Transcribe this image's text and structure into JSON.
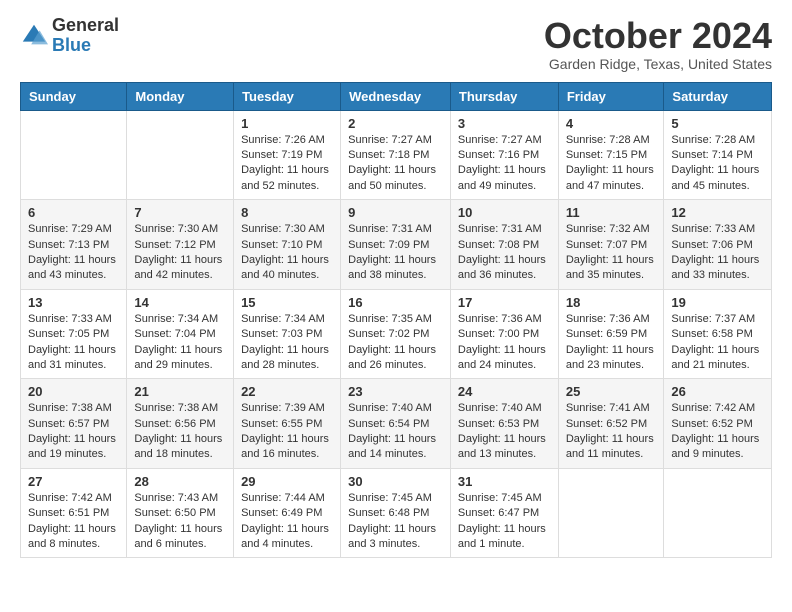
{
  "header": {
    "logo_general": "General",
    "logo_blue": "Blue",
    "month_title": "October 2024",
    "location": "Garden Ridge, Texas, United States"
  },
  "days_of_week": [
    "Sunday",
    "Monday",
    "Tuesday",
    "Wednesday",
    "Thursday",
    "Friday",
    "Saturday"
  ],
  "weeks": [
    [
      {
        "day": "",
        "sunrise": "",
        "sunset": "",
        "daylight": ""
      },
      {
        "day": "",
        "sunrise": "",
        "sunset": "",
        "daylight": ""
      },
      {
        "day": "1",
        "sunrise": "Sunrise: 7:26 AM",
        "sunset": "Sunset: 7:19 PM",
        "daylight": "Daylight: 11 hours and 52 minutes."
      },
      {
        "day": "2",
        "sunrise": "Sunrise: 7:27 AM",
        "sunset": "Sunset: 7:18 PM",
        "daylight": "Daylight: 11 hours and 50 minutes."
      },
      {
        "day": "3",
        "sunrise": "Sunrise: 7:27 AM",
        "sunset": "Sunset: 7:16 PM",
        "daylight": "Daylight: 11 hours and 49 minutes."
      },
      {
        "day": "4",
        "sunrise": "Sunrise: 7:28 AM",
        "sunset": "Sunset: 7:15 PM",
        "daylight": "Daylight: 11 hours and 47 minutes."
      },
      {
        "day": "5",
        "sunrise": "Sunrise: 7:28 AM",
        "sunset": "Sunset: 7:14 PM",
        "daylight": "Daylight: 11 hours and 45 minutes."
      }
    ],
    [
      {
        "day": "6",
        "sunrise": "Sunrise: 7:29 AM",
        "sunset": "Sunset: 7:13 PM",
        "daylight": "Daylight: 11 hours and 43 minutes."
      },
      {
        "day": "7",
        "sunrise": "Sunrise: 7:30 AM",
        "sunset": "Sunset: 7:12 PM",
        "daylight": "Daylight: 11 hours and 42 minutes."
      },
      {
        "day": "8",
        "sunrise": "Sunrise: 7:30 AM",
        "sunset": "Sunset: 7:10 PM",
        "daylight": "Daylight: 11 hours and 40 minutes."
      },
      {
        "day": "9",
        "sunrise": "Sunrise: 7:31 AM",
        "sunset": "Sunset: 7:09 PM",
        "daylight": "Daylight: 11 hours and 38 minutes."
      },
      {
        "day": "10",
        "sunrise": "Sunrise: 7:31 AM",
        "sunset": "Sunset: 7:08 PM",
        "daylight": "Daylight: 11 hours and 36 minutes."
      },
      {
        "day": "11",
        "sunrise": "Sunrise: 7:32 AM",
        "sunset": "Sunset: 7:07 PM",
        "daylight": "Daylight: 11 hours and 35 minutes."
      },
      {
        "day": "12",
        "sunrise": "Sunrise: 7:33 AM",
        "sunset": "Sunset: 7:06 PM",
        "daylight": "Daylight: 11 hours and 33 minutes."
      }
    ],
    [
      {
        "day": "13",
        "sunrise": "Sunrise: 7:33 AM",
        "sunset": "Sunset: 7:05 PM",
        "daylight": "Daylight: 11 hours and 31 minutes."
      },
      {
        "day": "14",
        "sunrise": "Sunrise: 7:34 AM",
        "sunset": "Sunset: 7:04 PM",
        "daylight": "Daylight: 11 hours and 29 minutes."
      },
      {
        "day": "15",
        "sunrise": "Sunrise: 7:34 AM",
        "sunset": "Sunset: 7:03 PM",
        "daylight": "Daylight: 11 hours and 28 minutes."
      },
      {
        "day": "16",
        "sunrise": "Sunrise: 7:35 AM",
        "sunset": "Sunset: 7:02 PM",
        "daylight": "Daylight: 11 hours and 26 minutes."
      },
      {
        "day": "17",
        "sunrise": "Sunrise: 7:36 AM",
        "sunset": "Sunset: 7:00 PM",
        "daylight": "Daylight: 11 hours and 24 minutes."
      },
      {
        "day": "18",
        "sunrise": "Sunrise: 7:36 AM",
        "sunset": "Sunset: 6:59 PM",
        "daylight": "Daylight: 11 hours and 23 minutes."
      },
      {
        "day": "19",
        "sunrise": "Sunrise: 7:37 AM",
        "sunset": "Sunset: 6:58 PM",
        "daylight": "Daylight: 11 hours and 21 minutes."
      }
    ],
    [
      {
        "day": "20",
        "sunrise": "Sunrise: 7:38 AM",
        "sunset": "Sunset: 6:57 PM",
        "daylight": "Daylight: 11 hours and 19 minutes."
      },
      {
        "day": "21",
        "sunrise": "Sunrise: 7:38 AM",
        "sunset": "Sunset: 6:56 PM",
        "daylight": "Daylight: 11 hours and 18 minutes."
      },
      {
        "day": "22",
        "sunrise": "Sunrise: 7:39 AM",
        "sunset": "Sunset: 6:55 PM",
        "daylight": "Daylight: 11 hours and 16 minutes."
      },
      {
        "day": "23",
        "sunrise": "Sunrise: 7:40 AM",
        "sunset": "Sunset: 6:54 PM",
        "daylight": "Daylight: 11 hours and 14 minutes."
      },
      {
        "day": "24",
        "sunrise": "Sunrise: 7:40 AM",
        "sunset": "Sunset: 6:53 PM",
        "daylight": "Daylight: 11 hours and 13 minutes."
      },
      {
        "day": "25",
        "sunrise": "Sunrise: 7:41 AM",
        "sunset": "Sunset: 6:52 PM",
        "daylight": "Daylight: 11 hours and 11 minutes."
      },
      {
        "day": "26",
        "sunrise": "Sunrise: 7:42 AM",
        "sunset": "Sunset: 6:52 PM",
        "daylight": "Daylight: 11 hours and 9 minutes."
      }
    ],
    [
      {
        "day": "27",
        "sunrise": "Sunrise: 7:42 AM",
        "sunset": "Sunset: 6:51 PM",
        "daylight": "Daylight: 11 hours and 8 minutes."
      },
      {
        "day": "28",
        "sunrise": "Sunrise: 7:43 AM",
        "sunset": "Sunset: 6:50 PM",
        "daylight": "Daylight: 11 hours and 6 minutes."
      },
      {
        "day": "29",
        "sunrise": "Sunrise: 7:44 AM",
        "sunset": "Sunset: 6:49 PM",
        "daylight": "Daylight: 11 hours and 4 minutes."
      },
      {
        "day": "30",
        "sunrise": "Sunrise: 7:45 AM",
        "sunset": "Sunset: 6:48 PM",
        "daylight": "Daylight: 11 hours and 3 minutes."
      },
      {
        "day": "31",
        "sunrise": "Sunrise: 7:45 AM",
        "sunset": "Sunset: 6:47 PM",
        "daylight": "Daylight: 11 hours and 1 minute."
      },
      {
        "day": "",
        "sunrise": "",
        "sunset": "",
        "daylight": ""
      },
      {
        "day": "",
        "sunrise": "",
        "sunset": "",
        "daylight": ""
      }
    ]
  ]
}
